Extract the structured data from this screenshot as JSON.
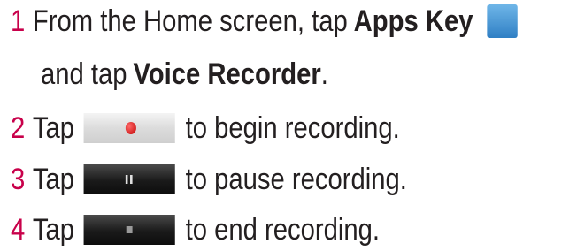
{
  "steps": [
    {
      "number": "1",
      "text_before": "From the Home screen, tap",
      "bold_1": "Apps Key",
      "icon": "apps-grid-icon",
      "line2_before": "and tap",
      "bold_2": "Voice Recorder",
      "line2_after": "."
    },
    {
      "number": "2",
      "before": "Tap",
      "button_icon": "record-button-icon",
      "after": "to begin recording."
    },
    {
      "number": "3",
      "before": "Tap",
      "button_icon": "pause-button-icon",
      "after": "to pause recording."
    },
    {
      "number": "4",
      "before": "Tap",
      "button_icon": "stop-button-icon",
      "after": "to end recording."
    }
  ],
  "colors": {
    "step_number": "#c8004a",
    "text": "#231f20"
  }
}
